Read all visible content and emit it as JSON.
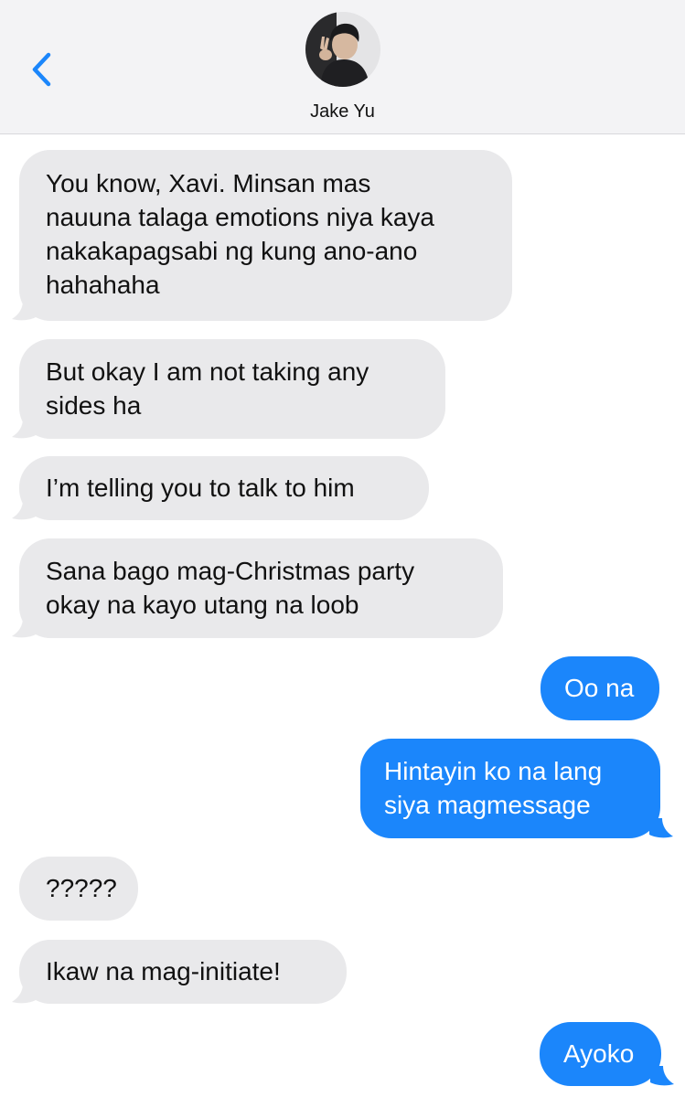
{
  "header": {
    "contact_name": "Jake Yu",
    "back_icon": "chevron-left-icon",
    "avatar_icon": "contact-avatar"
  },
  "colors": {
    "header_bg": "#f3f3f5",
    "incoming_bubble": "#e9e9eb",
    "outgoing_bubble": "#1b86fb",
    "accent": "#1b86fb"
  },
  "messages": [
    {
      "direction": "incoming",
      "lines": [
        "You know, Xavi. Minsan mas",
        "nauuna talaga emotions niya kaya",
        "nakakapagsabi ng kung ano-ano",
        "hahahaha"
      ]
    },
    {
      "direction": "incoming",
      "lines": [
        "But okay I am not taking any",
        "sides ha"
      ]
    },
    {
      "direction": "incoming",
      "lines": [
        "I’m telling you to talk to him"
      ]
    },
    {
      "direction": "incoming",
      "lines": [
        "Sana bago mag-Christmas party",
        "okay na kayo utang na loob"
      ]
    },
    {
      "direction": "outgoing",
      "lines": [
        "Oo na"
      ]
    },
    {
      "direction": "outgoing",
      "lines": [
        "Hintayin ko na lang",
        "siya magmessage"
      ]
    },
    {
      "direction": "incoming",
      "lines": [
        "?????"
      ]
    },
    {
      "direction": "incoming",
      "lines": [
        "Ikaw na mag-initiate!"
      ]
    },
    {
      "direction": "outgoing",
      "lines": [
        "Ayoko"
      ]
    }
  ]
}
